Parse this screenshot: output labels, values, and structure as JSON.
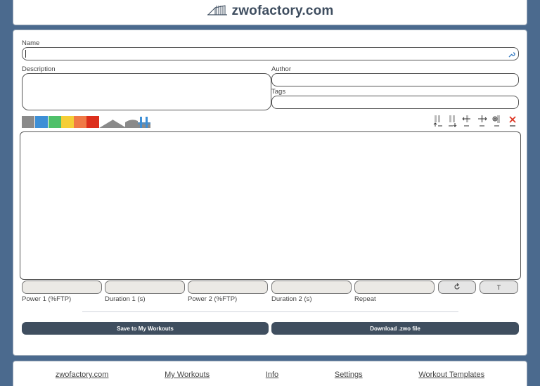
{
  "header": {
    "title": "zwofactory.com",
    "logo_icon": "stair-steps-logo-icon"
  },
  "form": {
    "name_label": "Name",
    "name_value": "",
    "description_label": "Description",
    "description_value": "",
    "author_label": "Author",
    "author_value": "",
    "tags_label": "Tags",
    "tags_value": ""
  },
  "palette": {
    "swatches": [
      {
        "name": "gray-zone",
        "color": "#8a8a8a"
      },
      {
        "name": "blue-zone",
        "color": "#3d8fd6"
      },
      {
        "name": "green-zone",
        "color": "#4fc06a"
      },
      {
        "name": "yellow-zone",
        "color": "#f5ce36"
      },
      {
        "name": "orange-zone",
        "color": "#f07a46"
      },
      {
        "name": "red-zone",
        "color": "#dc2f1c"
      }
    ],
    "shapes": [
      "warmup-ramp-icon",
      "cooldown-ramp-icon",
      "freeride-icon",
      "interval-icon"
    ]
  },
  "toolbar": {
    "tools": [
      "move-up-icon",
      "move-down-icon",
      "shift-left-icon",
      "shift-right-icon",
      "duplicate-icon",
      "delete-icon"
    ],
    "delete_color": "#dc2f1c"
  },
  "inputs": {
    "power1_label": "Power 1 (%FTP)",
    "duration1_label": "Duration 1 (s)",
    "power2_label": "Power 2 (%FTP)",
    "duration2_label": "Duration 2 (s)",
    "repeat_label": "Repeat",
    "power1_value": "",
    "duration1_value": "",
    "power2_value": "",
    "duration2_value": "",
    "repeat_value": "",
    "text_button": "T"
  },
  "actions": {
    "save_label": "Save to My Workouts",
    "download_label": "Download .zwo file"
  },
  "footer": {
    "links": [
      "zwofactory.com",
      "My Workouts",
      "Info",
      "Settings",
      "Workout Templates"
    ]
  }
}
